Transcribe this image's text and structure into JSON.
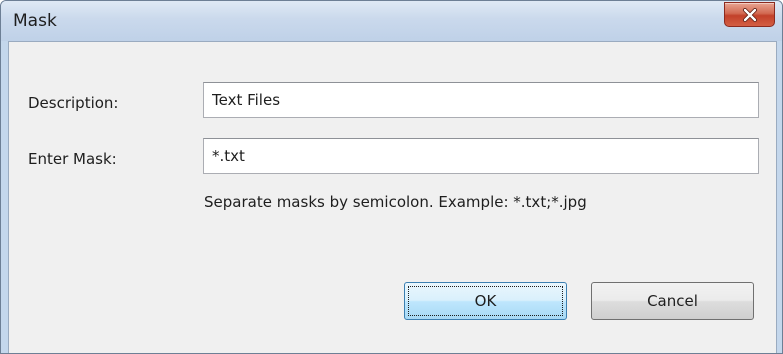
{
  "window": {
    "title": "Mask",
    "close_icon": "close-icon"
  },
  "form": {
    "description_label": "Description:",
    "description_value": "Text Files",
    "mask_label": "Enter Mask:",
    "mask_value": "*.txt",
    "hint": "Separate masks by semicolon. Example: *.txt;*.jpg"
  },
  "buttons": {
    "ok_label": "OK",
    "cancel_label": "Cancel"
  },
  "colors": {
    "titlebar": "#c4d7ec",
    "close_button": "#c7432b",
    "client_background": "#f0f0f0",
    "default_button_border": "#3c7fb1"
  }
}
